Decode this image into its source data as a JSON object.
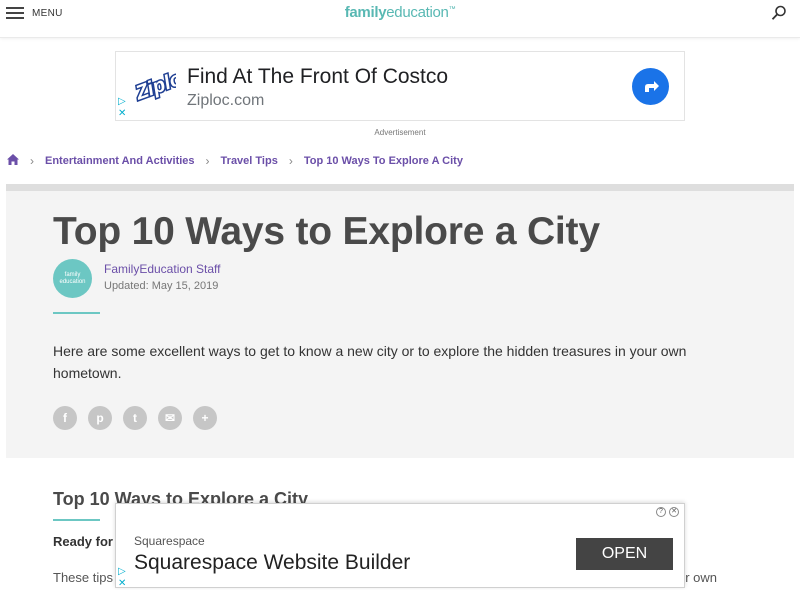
{
  "header": {
    "menu_label": "MENU",
    "logo_bold": "family",
    "logo_regular": "education",
    "logo_tm": "™",
    "icons": {
      "menu": "hamburger-icon",
      "search": "search-icon"
    }
  },
  "ad_top": {
    "title": "Find At The Front Of Costco",
    "url": "Ziploc.com",
    "brand": "Ziploc",
    "label": "Advertisement",
    "icons": {
      "go": "arrow-right-icon",
      "adchoices": "adchoices-icon",
      "close": "close-icon"
    }
  },
  "breadcrumb": {
    "items": [
      "Entertainment And Activities",
      "Travel Tips",
      "Top 10 Ways To Explore A City"
    ],
    "home_icon": "home-icon",
    "separator": "›"
  },
  "article": {
    "title": "Top 10 Ways to Explore a City",
    "author": "FamilyEducation Staff",
    "updated": "Updated: May 15, 2019",
    "avatar_text_1": "family",
    "avatar_text_2": "education",
    "description": "Here are some excellent ways to get to know a new city or to explore the hidden treasures in your own hometown.",
    "share": [
      {
        "icon": "facebook-icon",
        "glyph": "f"
      },
      {
        "icon": "pinterest-icon",
        "glyph": "p"
      },
      {
        "icon": "twitter-icon",
        "glyph": "t"
      },
      {
        "icon": "email-icon",
        "glyph": "✉"
      },
      {
        "icon": "more-icon",
        "glyph": "+"
      }
    ],
    "section_heading": "Top 10 Ways to Explore a City",
    "para_bold_start": "Ready for",
    "para_start": "These tips",
    "para_tail": "ur own"
  },
  "ad_bottom": {
    "brand": "Squarespace",
    "title": "Squarespace Website Builder",
    "cta": "OPEN",
    "icons": {
      "info": "info-icon",
      "close": "close-icon",
      "adchoices": "adchoices-icon"
    }
  },
  "colors": {
    "accent_teal": "#58b8b3",
    "link_purple": "#6b4fa8",
    "ad_blue": "#1a73e8"
  }
}
